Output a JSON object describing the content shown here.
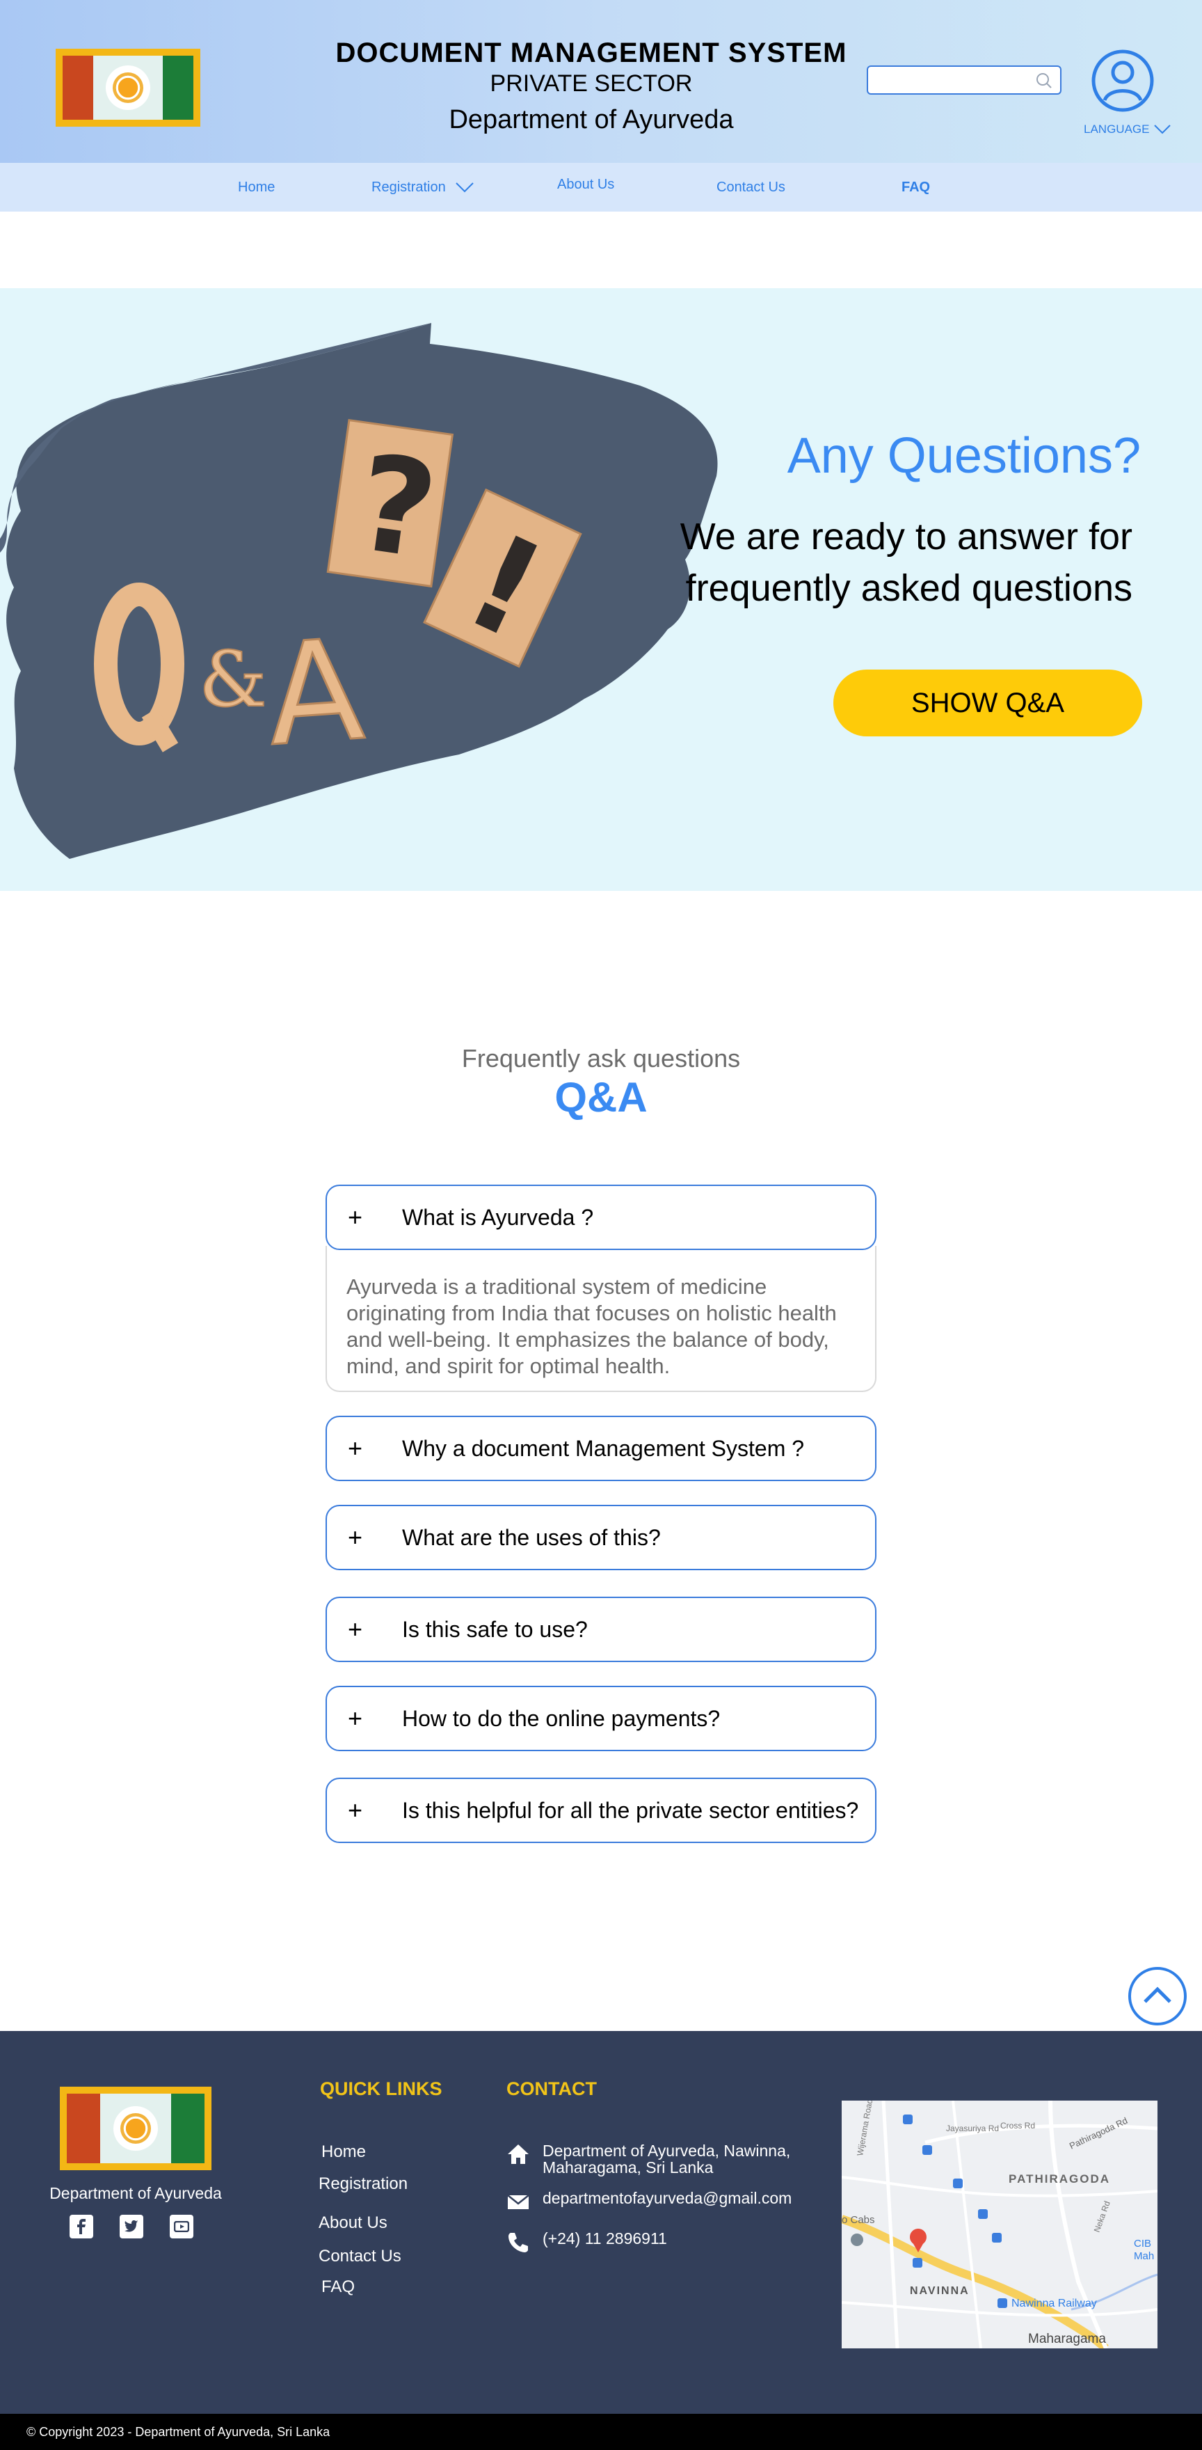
{
  "header": {
    "title": "DOCUMENT  MANAGEMENT  SYSTEM",
    "subtitle": "PRIVATE SECTOR",
    "department": "Department of Ayurveda",
    "search_placeholder": "",
    "language_label": "LANGUAGE"
  },
  "nav": {
    "items": [
      {
        "label": "Home"
      },
      {
        "label": "Registration"
      },
      {
        "label": "About Us"
      },
      {
        "label": "Contact Us"
      },
      {
        "label": "FAQ"
      }
    ],
    "active": "FAQ"
  },
  "hero": {
    "title": "Any Questions?",
    "text": "We are ready to answer for frequently asked questions",
    "button_label": "SHOW Q&A",
    "image_letters": [
      "Q",
      "&",
      "A",
      "?",
      "!"
    ]
  },
  "faq": {
    "kicker": "Frequently ask questions",
    "heading": "Q&A",
    "items": [
      {
        "question": "What is Ayurveda ?",
        "expanded": true,
        "answer": "Ayurveda is a traditional system of medicine originating from India that focuses on holistic health and well-being. It emphasizes the balance of body, mind, and spirit for optimal health."
      },
      {
        "question": "Why a document Management System ?",
        "expanded": false
      },
      {
        "question": "What are the uses of this?",
        "expanded": false
      },
      {
        "question": "Is this safe to use?",
        "expanded": false
      },
      {
        "question": "How to do the online payments?",
        "expanded": false
      },
      {
        "question": "Is this helpful for all the private sector entities?",
        "expanded": false
      }
    ],
    "toggle_symbol": "+"
  },
  "footer": {
    "department": "Department of Ayurveda",
    "quick_links_title": "QUICK LINKS",
    "quick_links": [
      "Home",
      "Registration",
      "About Us",
      "Contact Us",
      "FAQ"
    ],
    "contact_title": "CONTACT",
    "address": "Department of Ayurveda, Nawinna, Maharagama, Sri Lanka",
    "email": "departmentofayurveda@gmail.com",
    "phone": "(+24) 11 2896911",
    "socials": [
      "facebook-icon",
      "twitter-icon",
      "youtube-icon"
    ],
    "map_labels": [
      "PATHIRAGODA",
      "NAVINNA",
      "Maharagama",
      "Nawinna Railway",
      "Pathiragoda Rd",
      "Jayasuriya Rd",
      "Cross Rd",
      "Wijerama Road",
      "Neka Rd",
      "CIB",
      "Mah",
      "o Cabs"
    ]
  },
  "copyright": "© Copyright 2023 - Department of Ayurveda, Sri Lanka",
  "colors": {
    "accent": "#3a8af2",
    "button": "#fecb09",
    "footer_bg": "#333f5a",
    "footer_heading": "#f2c418",
    "hero_bg": "#e2f6fb",
    "nav_bg": "#d6e6fb"
  }
}
